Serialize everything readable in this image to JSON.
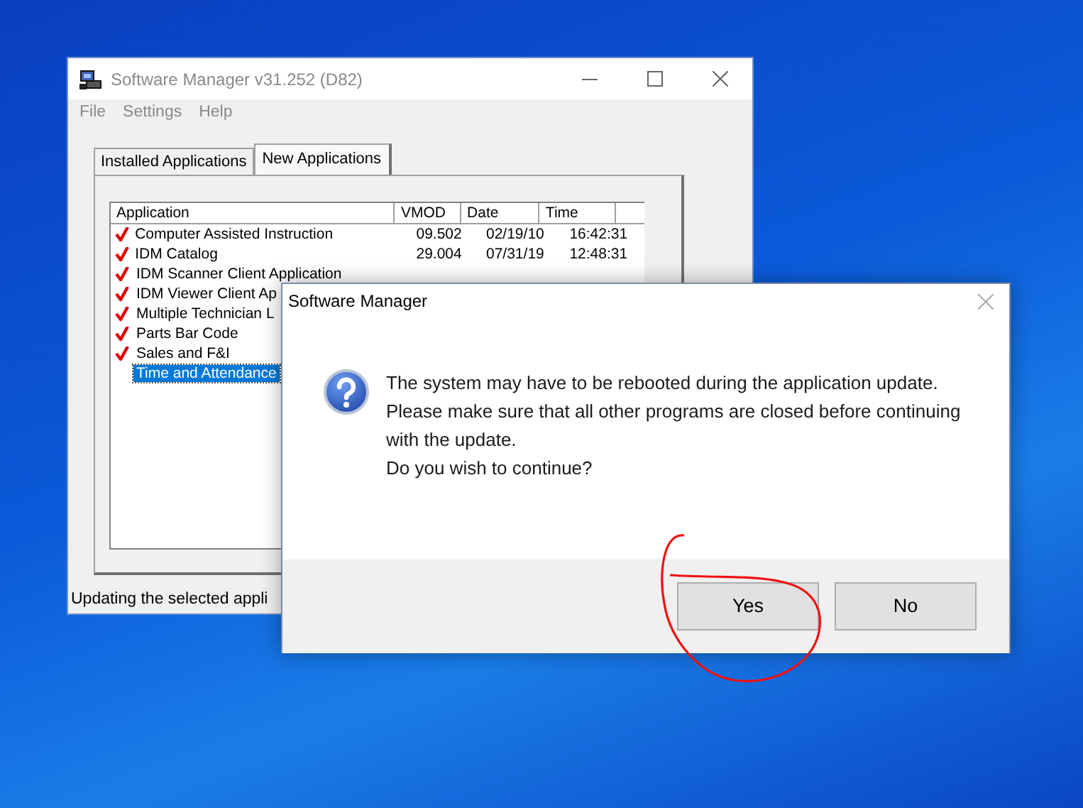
{
  "main_window": {
    "title": "Software Manager v31.252 (D82)",
    "menu": [
      "File",
      "Settings",
      "Help"
    ],
    "tabs": [
      {
        "label": "Installed Applications",
        "selected": false
      },
      {
        "label": "New Applications",
        "selected": true
      }
    ],
    "table": {
      "columns": [
        "Application",
        "VMOD",
        "Date",
        "Time"
      ],
      "rows": [
        {
          "cells": [
            "Computer Assisted Instruction",
            "09.502",
            "02/19/10",
            "16:42:31"
          ],
          "checked": true,
          "selected": false
        },
        {
          "cells": [
            "IDM Catalog",
            "29.004",
            "07/31/19",
            "12:48:31"
          ],
          "checked": true,
          "selected": false
        },
        {
          "cells": [
            "IDM Scanner Client Application"
          ],
          "checked": true,
          "selected": false
        },
        {
          "cells": [
            "IDM Viewer Client Ap"
          ],
          "checked": true,
          "selected": false
        },
        {
          "cells": [
            "Multiple Technician L"
          ],
          "checked": true,
          "selected": false
        },
        {
          "cells": [
            "Parts Bar Code"
          ],
          "checked": true,
          "selected": false
        },
        {
          "cells": [
            "Sales and F&I"
          ],
          "checked": true,
          "selected": false
        },
        {
          "cells": [
            "Time and Attendance"
          ],
          "checked": false,
          "selected": true
        }
      ]
    },
    "status_bar": "Updating the selected appli"
  },
  "dialog": {
    "title": "Software Manager",
    "message": [
      "The system may have to be rebooted during the application update.",
      "Please make sure that all other programs are closed before continuing with the update.",
      "Do you wish to continue?"
    ],
    "buttons": [
      "Yes",
      "No"
    ]
  }
}
